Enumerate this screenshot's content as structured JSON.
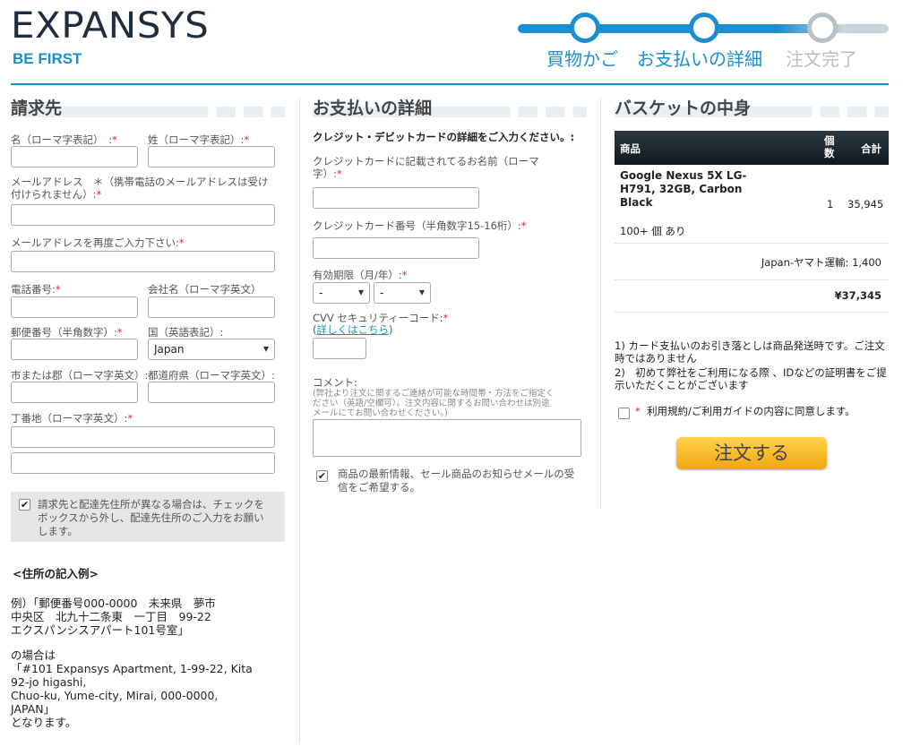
{
  "header": {
    "logo": "EXPANSYS",
    "tagline": "BE FIRST",
    "steps": [
      "買物かご",
      "お支払いの詳細",
      "注文完了"
    ]
  },
  "billing": {
    "title": "請求先",
    "first_name_label": "名（ローマ字表記）　:",
    "last_name_label": "姓（ローマ字表記）:",
    "email_label": "メールアドレス　＊（携帯電話のメールアドレスは受け付けられません）:",
    "email_confirm_label": "メールアドレスを再度ご入力下さい:",
    "phone_label": "電話番号:",
    "company_label": "会社名（ローマ字英文）",
    "postcode_label": "郵便番号（半角数字）:",
    "country_label": "国（英語表記）:",
    "country_value": "Japan",
    "city_label": "市または郡（ローマ字英文）:",
    "prefecture_label": "都道府県（ローマ字英文）:",
    "address_label": "丁番地（ローマ字英文）:",
    "delivery_note": "請求先と配達先住所が異なる場合は、チェックをボックスから外し、配達先住所のご入力をお願いします。",
    "example_title": "<住所の記入例>",
    "example_lines": [
      "例）「郵便番号000-0000　未来県　夢市",
      "中央区　北九十二条東　一丁目　99-22",
      "エクスパンシスアパート101号室」",
      "",
      "の場合は",
      "「#101 Expansys Apartment, 1-99-22, Kita",
      "92-jo higashi,",
      "Chuo-ku, Yume-city, Mirai, 000-0000,",
      "JAPAN」",
      "となります。"
    ]
  },
  "payment": {
    "title": "お支払いの詳細",
    "card_heading": "クレジット・デビットカードの詳細をご入力ください。:",
    "card_name_label": "クレジットカードに記載されてるお名前（ローマ字）:",
    "card_number_label": "クレジットカード番号（半角数字15-16桁）:",
    "expiry_label": "有効期限（月/年）:",
    "expiry_month": "-",
    "expiry_year": "-",
    "cvv_label": "CVV セキュリティーコード:",
    "cvv_link": "詳しくはこちら",
    "comment_label": "コメント:",
    "comment_hint": "(弊社より注文に関するご連絡が可能な時間帯・方法をご指定ください（英語/空欄可）。注文内容に関するお問い合わせは別途メールにてお問い合わせください。)",
    "newsletter_label": "商品の最新情報、セール商品のお知らせメールの受信をご希望する。"
  },
  "basket": {
    "title": "バスケットの中身",
    "col_product": "商品",
    "col_qty": "個数",
    "col_total": "合計",
    "item_name": "Google Nexus 5X LG-H791, 32GB, Carbon Black",
    "item_qty": "1",
    "item_price": "35,945",
    "stock": "100+ 個 あり",
    "shipping": "Japan-ヤマト運輸: 1,400",
    "grand_total": "¥37,345",
    "note1": "1) カード支払いのお引き落としは商品発送時です。ご注文時ではありません",
    "note2": "2)　初めて弊社をご利用になる際 、IDなどの証明書をご提示いただくことがございます",
    "terms_label": "利用規約/ご利用ガイドの内容に同意します。",
    "order_button": "注文する"
  },
  "colors": {
    "accent": "#1a8ed0",
    "required": "#d9262f",
    "button": "#f2a60f"
  }
}
